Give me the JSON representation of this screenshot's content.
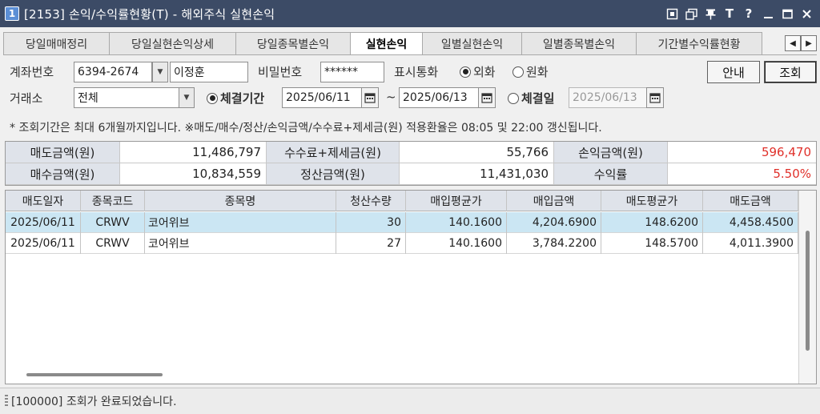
{
  "window": {
    "number_badge": "1",
    "title": "[2153] 손익/수익률현황(T) - 해외주식 실현손익",
    "controls": [
      "window-restore-icon",
      "window-tile-icon",
      "pin-icon",
      "font-size-icon",
      "help-icon",
      "minimize-icon",
      "maximize-icon",
      "close-icon"
    ],
    "font_glyph": "T",
    "help_glyph": "?"
  },
  "tabs": [
    {
      "label": "당일매매정리",
      "active": false
    },
    {
      "label": "당일실현손익상세",
      "active": false
    },
    {
      "label": "당일종목별손익",
      "active": false
    },
    {
      "label": "실현손익",
      "active": true
    },
    {
      "label": "일별실현손익",
      "active": false
    },
    {
      "label": "일별종목별손익",
      "active": false
    },
    {
      "label": "기간별수익률현황",
      "active": false
    }
  ],
  "form": {
    "account_label": "계좌번호",
    "account_value": "6394-2674",
    "account_name": "이정훈",
    "password_label": "비밀번호",
    "password_value": "******",
    "currency_label": "표시통화",
    "currency_options": [
      "외화",
      "원화"
    ],
    "currency_selected": "외화",
    "guide_button": "안내",
    "query_button": "조회",
    "exchange_label": "거래소",
    "exchange_value": "전체",
    "period_radio_label": "체결기간",
    "period_from": "2025/06/11",
    "period_tilde": "~",
    "period_to": "2025/06/13",
    "date_radio_label": "체결일",
    "date_value": "2025/06/13",
    "period_selected": true,
    "notice": "* 조회기간은 최대 6개월까지입니다. ※매도/매수/정산/손익금액/수수료+제세금(원) 적용환율은 08:05 및 22:00 갱신됩니다."
  },
  "summary": {
    "row1": [
      {
        "label": "매도금액(원)",
        "value": "11,486,797"
      },
      {
        "label": "수수료+제세금(원)",
        "value": "55,766"
      },
      {
        "label": "손익금액(원)",
        "value": "596,470",
        "highlight": "red"
      }
    ],
    "row2": [
      {
        "label": "매수금액(원)",
        "value": "10,834,559"
      },
      {
        "label": "정산금액(원)",
        "value": "11,431,030"
      },
      {
        "label": "수익률",
        "value": "5.50%",
        "highlight": "red"
      }
    ],
    "highlight_color": "#e0302a"
  },
  "grid": {
    "columns": [
      "매도일자",
      "종목코드",
      "종목명",
      "청산수량",
      "매입평균가",
      "매입금액",
      "매도평균가",
      "매도금액"
    ],
    "rows": [
      [
        "2025/06/11",
        "CRWV",
        "코어위브",
        "30",
        "140.1600",
        "4,204.6900",
        "148.6200",
        "4,458.4500"
      ],
      [
        "2025/06/11",
        "CRWV",
        "코어위브",
        "27",
        "140.1600",
        "3,784.2200",
        "148.5700",
        "4,011.3900"
      ]
    ],
    "selected_row": 0,
    "selected_color": "#cbe6f3"
  },
  "status": {
    "message": "[100000] 조회가 완료되었습니다."
  },
  "colors": {
    "titlebar": "#3c4b66",
    "header_bg": "#dfe3ea",
    "accent_red": "#e0302a"
  }
}
